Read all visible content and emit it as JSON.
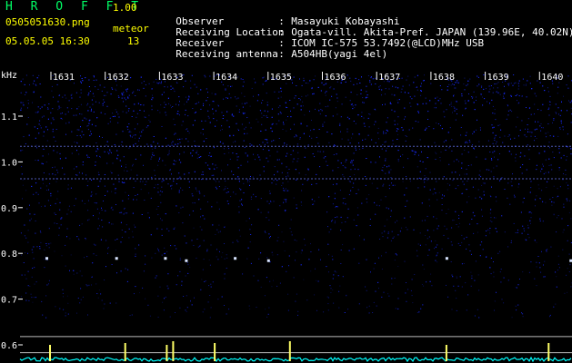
{
  "app": {
    "title": "H R O F F T",
    "version": "1.00"
  },
  "file_name": "0505051630.png",
  "date_time": "05.05.05 16:30",
  "meteor": {
    "label": "meteor",
    "count": "13"
  },
  "info": [
    {
      "label": "Observer",
      "value": "Masayuki Kobayashi"
    },
    {
      "label": "Receiving Location",
      "value": "Ogata-vill. Akita-Pref. JAPAN (139.96E, 40.02N)"
    },
    {
      "label": "Receiver",
      "value": "ICOM IC-575 53.7492(@LCD)MHz USB"
    },
    {
      "label": "Receiving antenna",
      "value": "A504HB(yagi 4el)"
    }
  ],
  "colors": {
    "title": "#00ff66",
    "accent": "#ffff00",
    "waterfall": "#1a2cff",
    "baseline": "#00ffff"
  },
  "chart_data": {
    "type": "heatmap",
    "y_unit_label": "kHz",
    "x_tick_labels": [
      "1631",
      "1632",
      "1633",
      "1634",
      "1635",
      "1636",
      "1637",
      "1638",
      "1639",
      "1640"
    ],
    "y_tick_labels": [
      "1.1",
      "1.0",
      "0.9",
      "0.8",
      "0.7",
      "0.6"
    ],
    "y_ticks": [
      1.1,
      1.0,
      0.9,
      0.8,
      0.7,
      0.6
    ],
    "ylim": [
      0.57,
      1.2
    ],
    "carrier_lines_khz": [
      1.034,
      0.963
    ],
    "meteor_echoes": [
      {
        "time": "1631",
        "freq_khz": 0.79
      },
      {
        "time": "1632",
        "freq_khz": 0.79
      },
      {
        "time": "1633",
        "freq_khz": 0.785
      },
      {
        "time": "1633",
        "freq_khz": 0.79
      },
      {
        "time": "1634",
        "freq_khz": 0.79
      },
      {
        "time": "1635",
        "freq_khz": 0.785
      },
      {
        "time": "1638",
        "freq_khz": 0.79
      },
      {
        "time": "1640",
        "freq_khz": 0.785
      }
    ]
  }
}
